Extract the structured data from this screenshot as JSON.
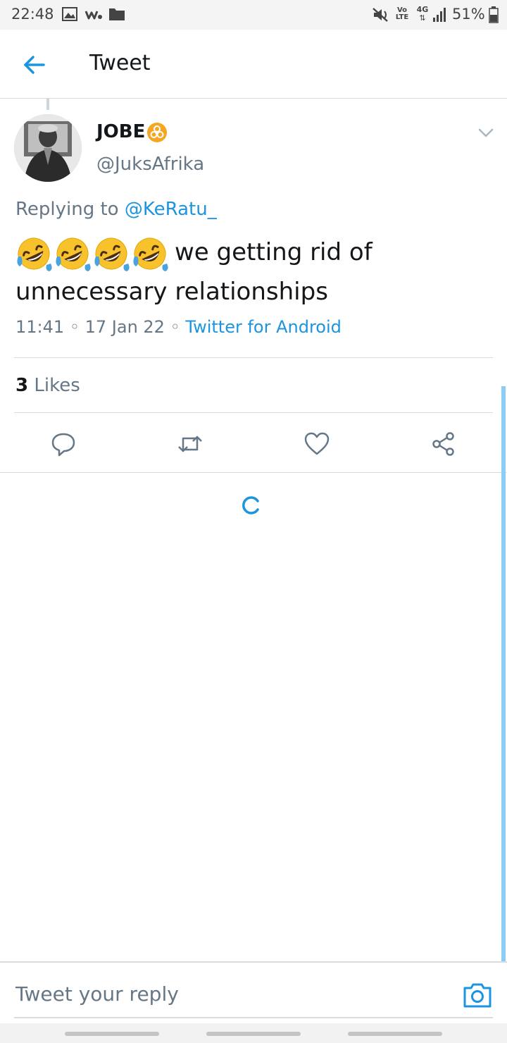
{
  "status_bar": {
    "time": "22:48",
    "battery_percent": "51%",
    "icons": [
      "image-icon",
      "walkman-icon",
      "folder-icon",
      "mute-icon",
      "volte-icon",
      "4g-icon",
      "signal-icon",
      "battery-icon"
    ],
    "volte_label": "Vo LTE",
    "network_label": "4G"
  },
  "header": {
    "title": "Tweet"
  },
  "tweet": {
    "display_name": "JOBE",
    "handle": "@JuksAfrika",
    "reply_prefix": "Replying to",
    "reply_to": "@KeRatu_",
    "emoji_count": 4,
    "text": "we getting rid of unnecessary relationships",
    "time": "11:41",
    "date": "17 Jan 22",
    "source": "Twitter for Android",
    "likes_count": "3",
    "likes_label": "Likes"
  },
  "composer": {
    "placeholder": "Tweet your reply"
  },
  "colors": {
    "accent": "#1b95e0",
    "muted": "#657786",
    "text": "#14171a",
    "divider": "#dcdcdc"
  }
}
